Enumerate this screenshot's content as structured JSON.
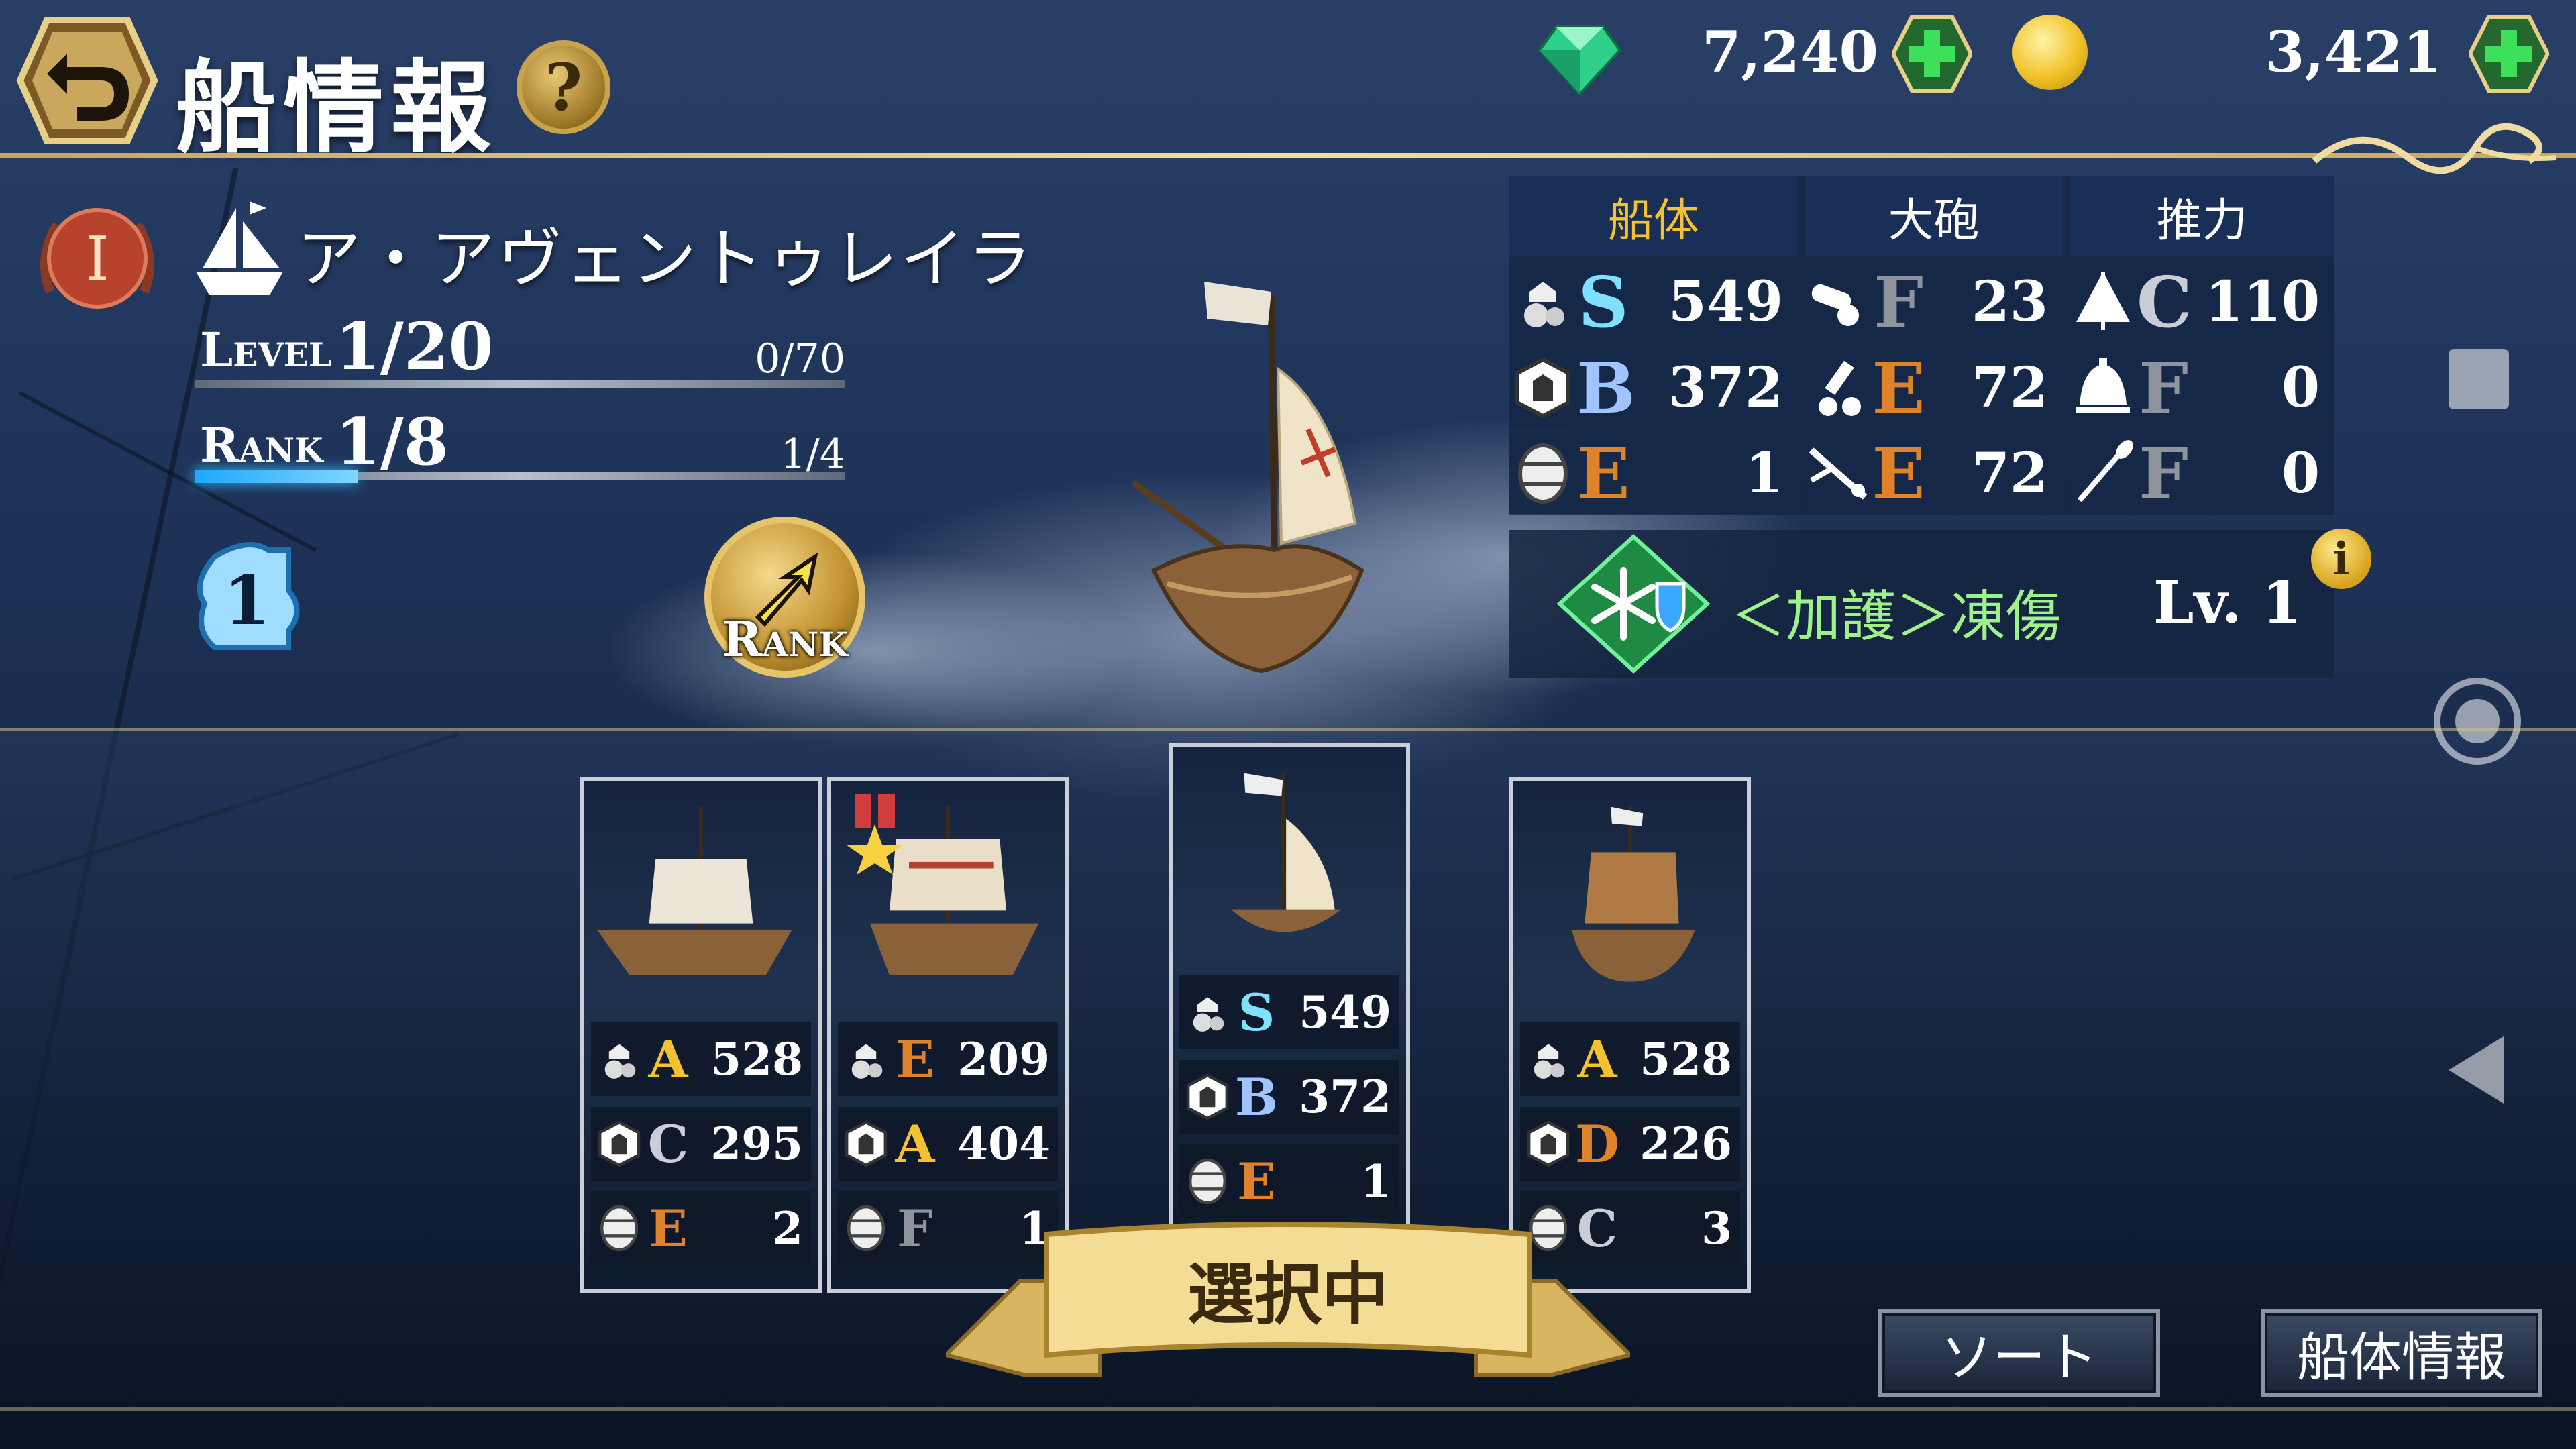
{
  "header": {
    "title": "船情報",
    "help_label": "?",
    "gems": "7,240",
    "coins": "3,421"
  },
  "ship": {
    "rank_numeral": "I",
    "name": "ア・アヴェントゥレイラ",
    "level_label": "Level",
    "level": "1/20",
    "level_exp": "0/70",
    "rank_label": "Rank",
    "rank": "1/8",
    "rank_exp": "1/4",
    "rank_progress": 0.25,
    "skill_slot": "1",
    "rankup_label": "Rank"
  },
  "stats": {
    "headers": [
      "船体",
      "大砲",
      "推力"
    ],
    "rows": [
      [
        {
          "icon": "crew-icon",
          "grade": "S",
          "value": "549"
        },
        {
          "icon": "cannon-icon",
          "grade": "F",
          "value": "23"
        },
        {
          "icon": "sail-icon",
          "grade": "C",
          "value": "110"
        }
      ],
      [
        {
          "icon": "armor-icon",
          "grade": "B",
          "value": "372"
        },
        {
          "icon": "mortar-icon",
          "grade": "E",
          "value": "72"
        },
        {
          "icon": "bell-icon",
          "grade": "F",
          "value": "0"
        }
      ],
      [
        {
          "icon": "barrel-icon",
          "grade": "E",
          "value": "1"
        },
        {
          "icon": "rifle-icon",
          "grade": "E",
          "value": "72"
        },
        {
          "icon": "oar-icon",
          "grade": "F",
          "value": "0"
        }
      ]
    ]
  },
  "skill": {
    "name": "＜加護＞凍傷",
    "level": "Lv. 1",
    "info": "i"
  },
  "cards": [
    {
      "medal": false,
      "rows": [
        {
          "icon": "crew-icon",
          "grade": "A",
          "value": "528"
        },
        {
          "icon": "armor-icon",
          "grade": "C",
          "value": "295"
        },
        {
          "icon": "barrel-icon",
          "grade": "E",
          "value": "2"
        }
      ]
    },
    {
      "medal": true,
      "rows": [
        {
          "icon": "crew-icon",
          "grade": "E",
          "value": "209"
        },
        {
          "icon": "armor-icon",
          "grade": "A",
          "value": "404"
        },
        {
          "icon": "barrel-icon",
          "grade": "F",
          "value": "1"
        }
      ]
    },
    {
      "medal": false,
      "selected": true,
      "rows": [
        {
          "icon": "crew-icon",
          "grade": "S",
          "value": "549"
        },
        {
          "icon": "armor-icon",
          "grade": "B",
          "value": "372"
        },
        {
          "icon": "barrel-icon",
          "grade": "E",
          "value": "1"
        }
      ]
    },
    {
      "medal": false,
      "rows": [
        {
          "icon": "crew-icon",
          "grade": "A",
          "value": "528"
        },
        {
          "icon": "armor-icon",
          "grade": "D",
          "value": "226"
        },
        {
          "icon": "barrel-icon",
          "grade": "C",
          "value": "3"
        }
      ]
    }
  ],
  "selected_banner": "選択中",
  "buttons": {
    "sort": "ソート",
    "hull_info": "船体情報"
  },
  "grade_colors": {
    "S": "#7fe0ff",
    "A": "#f2c230",
    "B": "#9fc4ff",
    "C": "#c9cdd6",
    "D": "#e0822a",
    "E": "#e0822a",
    "F": "#8f949c"
  }
}
